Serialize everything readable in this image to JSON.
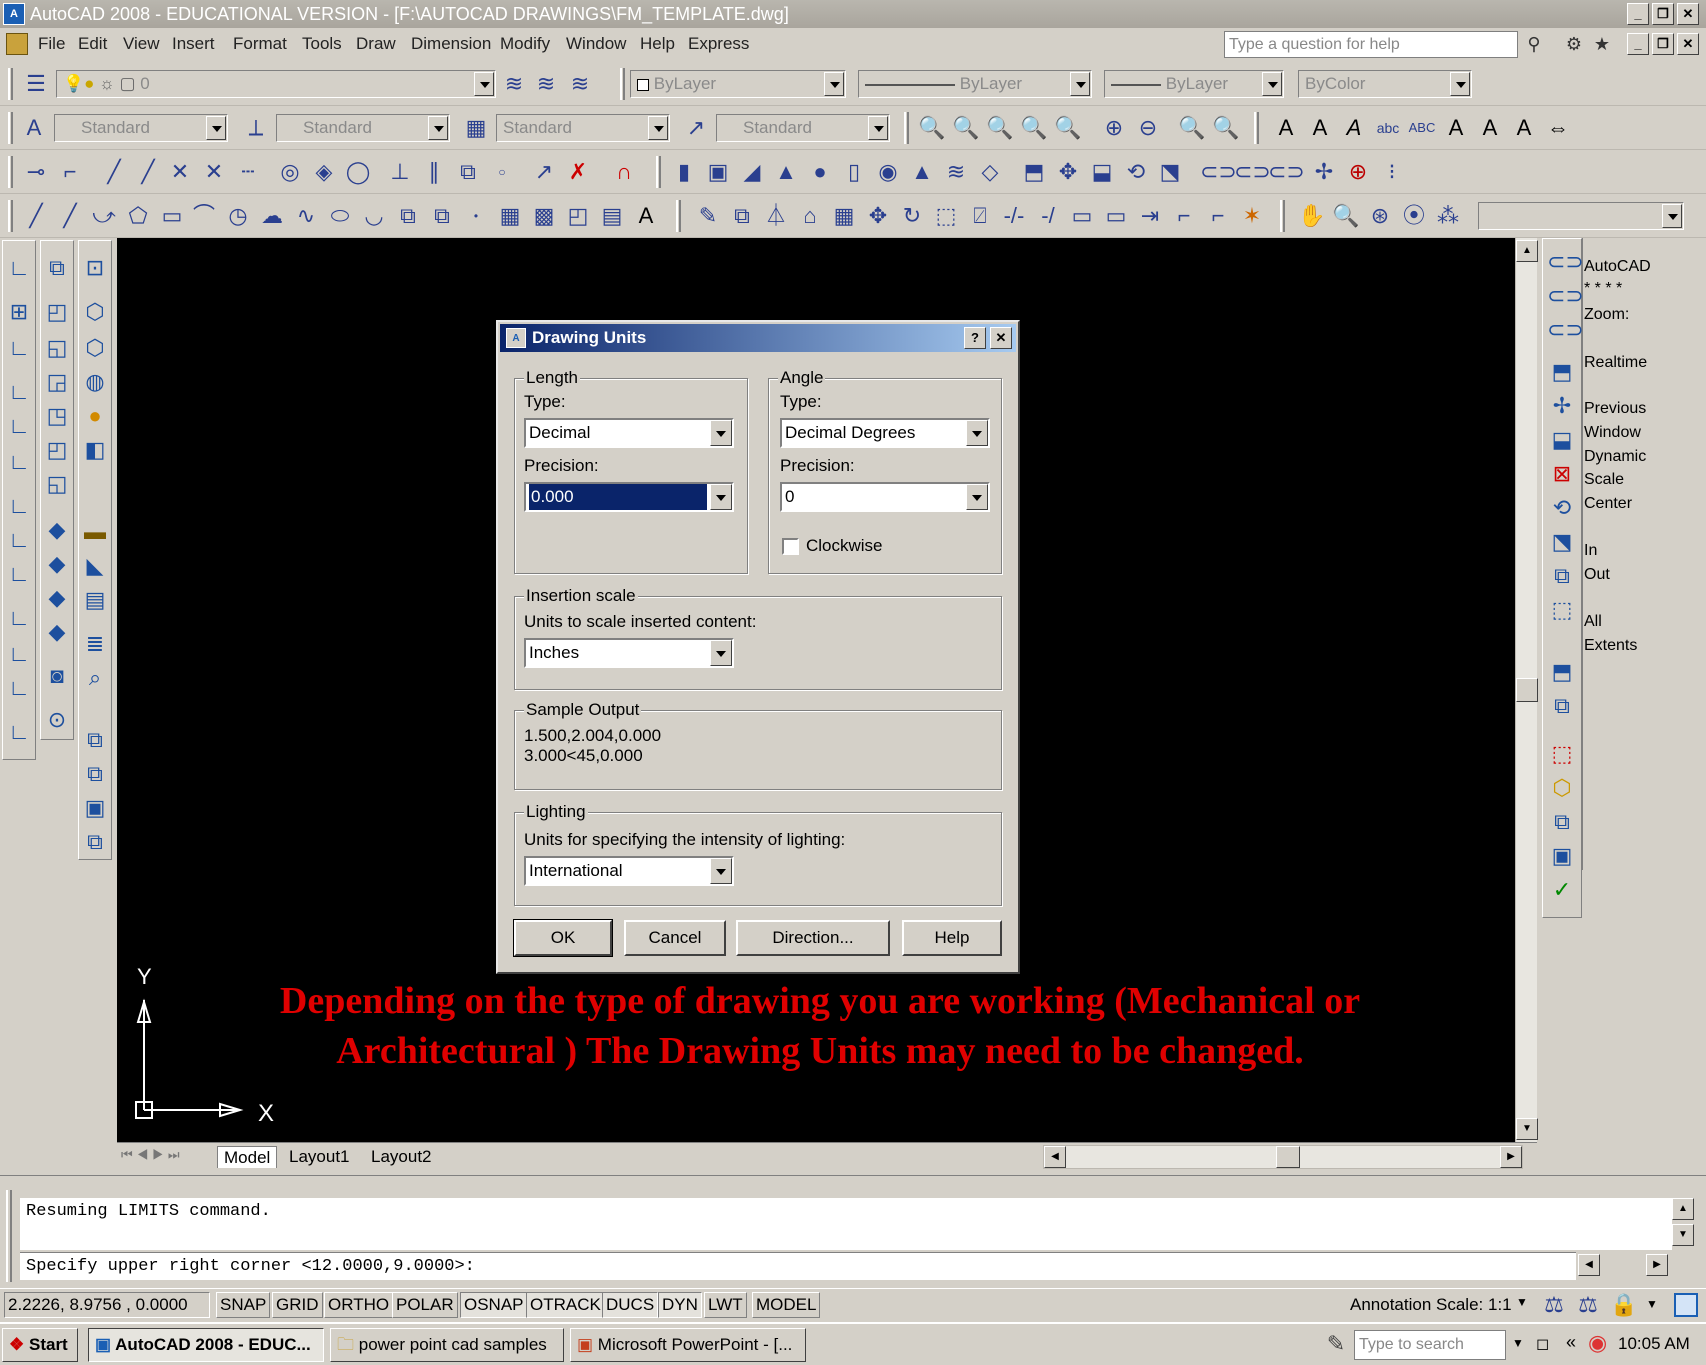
{
  "window": {
    "title": "AutoCAD 2008 - EDUCATIONAL VERSION - [F:\\AUTOCAD DRAWINGS\\FM_TEMPLATE.dwg]",
    "app_icon_text": "A"
  },
  "menubar": {
    "items": [
      "File",
      "Edit",
      "View",
      "Insert",
      "Format",
      "Tools",
      "Draw",
      "Dimension",
      "Modify",
      "Window",
      "Help",
      "Express"
    ],
    "help_search_placeholder": "Type a question for help"
  },
  "layers_toolbar": {
    "current_layer": "0",
    "color": "ByLayer",
    "linetype": "ByLayer",
    "lineweight": "ByLayer",
    "plotstyle": "ByColor"
  },
  "styles_toolbar": {
    "text_style": "Standard",
    "dim_style": "Standard",
    "table_style": "Standard",
    "multileader_style": "Standard"
  },
  "zoom_panel": {
    "lines": [
      "AutoCAD",
      "* * * *",
      "Zoom:",
      "",
      "Realtime",
      "",
      "Previous",
      "Window",
      "Dynamic",
      "Scale",
      "Center",
      "",
      "In",
      "Out",
      "",
      "All",
      "Extents"
    ]
  },
  "dialog": {
    "title": "Drawing Units",
    "help_glyph": "?",
    "close_glyph": "✕",
    "length": {
      "group_label": "Length",
      "type_label": "Type:",
      "type_value": "Decimal",
      "precision_label": "Precision:",
      "precision_value": "0.000"
    },
    "angle": {
      "group_label": "Angle",
      "type_label": "Type:",
      "type_value": "Decimal Degrees",
      "precision_label": "Precision:",
      "precision_value": "0",
      "clockwise_label": "Clockwise",
      "clockwise_checked": false
    },
    "insertion": {
      "group_label": "Insertion scale",
      "desc": "Units to scale inserted content:",
      "value": "Inches"
    },
    "sample": {
      "group_label": "Sample Output",
      "line1": "1.500,2.004,0.000",
      "line2": "3.000<45,0.000"
    },
    "lighting": {
      "group_label": "Lighting",
      "desc": "Units for specifying the intensity of lighting:",
      "value": "International"
    },
    "buttons": {
      "ok": "OK",
      "cancel": "Cancel",
      "direction": "Direction...",
      "help": "Help"
    }
  },
  "ucs": {
    "x_label": "X",
    "y_label": "Y"
  },
  "caption": {
    "line1": "Depending on the type of drawing you are working (Mechanical or",
    "line2": "Architectural ) The Drawing Units may need to be changed."
  },
  "tabs": [
    "Model",
    "Layout1",
    "Layout2"
  ],
  "command": {
    "line1": "Resuming LIMITS command.",
    "line2": "Specify upper right corner <12.0000,9.0000>:"
  },
  "status": {
    "coords": "2.2226,  8.9756 , 0.0000",
    "toggles": [
      "SNAP",
      "GRID",
      "ORTHO",
      "POLAR",
      "OSNAP",
      "OTRACK",
      "DUCS",
      "DYN",
      "LWT",
      "MODEL"
    ],
    "annotation_scale_label": "Annotation Scale:",
    "annotation_scale_value": "1:1"
  },
  "taskbar": {
    "start": "Start",
    "tasks": [
      "AutoCAD 2008 - EDUC...",
      "power point cad samples",
      "Microsoft PowerPoint - [..."
    ],
    "search_placeholder": "Type to search",
    "clock": "10:05 AM"
  }
}
